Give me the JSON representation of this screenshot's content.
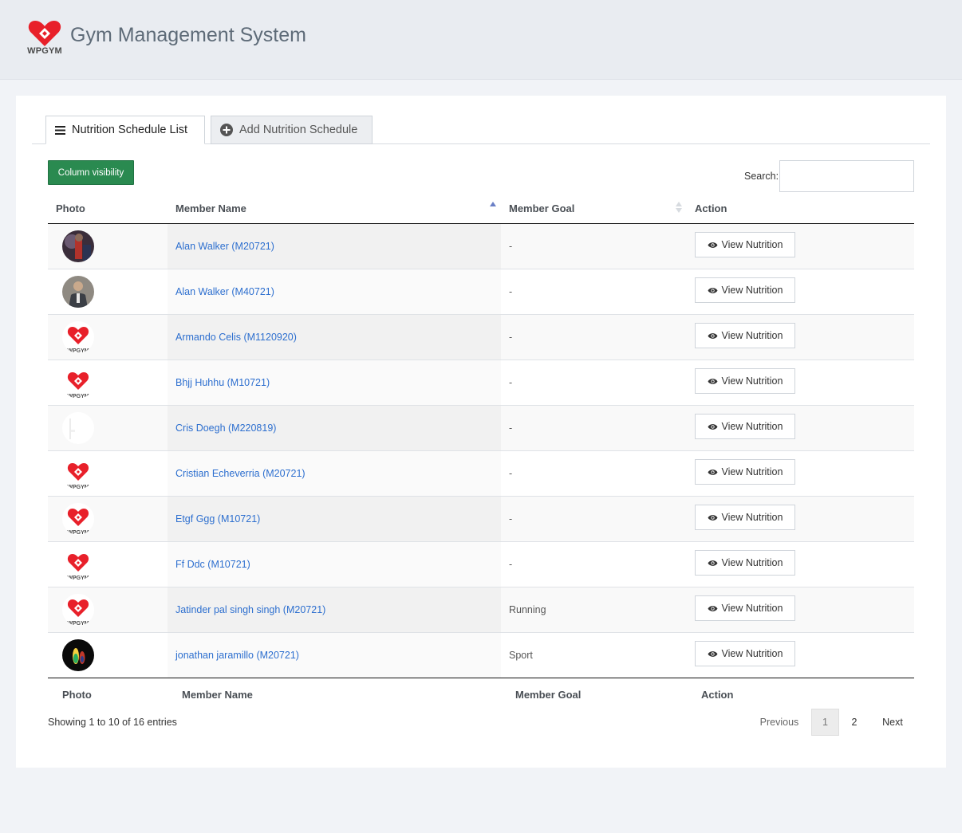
{
  "app": {
    "title": "Gym Management System",
    "logo_text": "WPGYM"
  },
  "tabs": [
    {
      "label": "Nutrition Schedule List",
      "icon": "list-icon",
      "active": true
    },
    {
      "label": "Add Nutrition Schedule",
      "icon": "plus-circle-icon",
      "active": false
    }
  ],
  "toolbar": {
    "column_visibility": "Column visibility",
    "search_label": "Search:",
    "search_value": ""
  },
  "table": {
    "columns": [
      "Photo",
      "Member Name",
      "Member Goal",
      "Action"
    ],
    "sorted_column": "Member Name",
    "sort_direction": "asc",
    "rows": [
      {
        "photo": "photo-dark-red",
        "name": "Alan Walker (M20721)",
        "goal": "-",
        "action": "View Nutrition"
      },
      {
        "photo": "photo-man-suit",
        "name": "Alan Walker (M40721)",
        "goal": "-",
        "action": "View Nutrition"
      },
      {
        "photo": "wpgym-logo",
        "name": "Armando Celis (M1120920)",
        "goal": "-",
        "action": "View Nutrition"
      },
      {
        "photo": "wpgym-logo",
        "name": "Bhjj Huhhu (M10721)",
        "goal": "-",
        "action": "View Nutrition"
      },
      {
        "photo": "photo-blank",
        "name": "Cris Doegh (M220819)",
        "goal": "-",
        "action": "View Nutrition"
      },
      {
        "photo": "wpgym-logo",
        "name": "Cristian Echeverria (M20721)",
        "goal": "-",
        "action": "View Nutrition"
      },
      {
        "photo": "wpgym-logo",
        "name": "Etgf Ggg (M10721)",
        "goal": "-",
        "action": "View Nutrition"
      },
      {
        "photo": "wpgym-logo",
        "name": "Ff Ddc (M10721)",
        "goal": "-",
        "action": "View Nutrition"
      },
      {
        "photo": "wpgym-logo",
        "name": "Jatinder pal singh singh (M20721)",
        "goal": "Running",
        "action": "View Nutrition"
      },
      {
        "photo": "photo-dark-color",
        "name": "jonathan jaramillo (M20721)",
        "goal": "Sport",
        "action": "View Nutrition"
      }
    ],
    "footer_columns": [
      "Photo",
      "Member Name",
      "Member Goal",
      "Action"
    ]
  },
  "pagination": {
    "info": "Showing 1 to 10 of 16 entries",
    "previous": "Previous",
    "pages": [
      "1",
      "2"
    ],
    "current_page": "1",
    "next": "Next"
  },
  "colors": {
    "accent_green": "#2a8a50",
    "link_blue": "#2d6fcf",
    "logo_red": "#e8202a"
  }
}
